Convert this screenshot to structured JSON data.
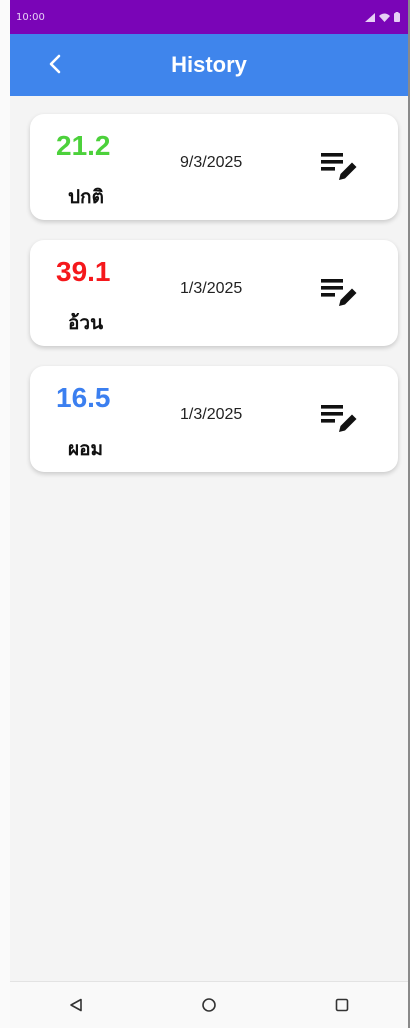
{
  "status_bar": {
    "time": "10:00"
  },
  "app_bar": {
    "title": "History",
    "back_icon": "chevron-left-icon"
  },
  "colors": {
    "normal": "#4cd13b",
    "obese": "#f5181c",
    "underweight": "#3b7ff0",
    "app_bar": "#3f85ec",
    "status_bar": "#7a05b7"
  },
  "records": [
    {
      "value": "21.2",
      "status": "ปกติ",
      "date": "9/3/2025",
      "color": "#4cd13b",
      "action_icon": "edit-list-icon"
    },
    {
      "value": "39.1",
      "status": "อ้วน",
      "date": "1/3/2025",
      "color": "#f5181c",
      "action_icon": "edit-list-icon"
    },
    {
      "value": "16.5",
      "status": "ผอม",
      "date": "1/3/2025",
      "color": "#3b7ff0",
      "action_icon": "edit-list-icon"
    }
  ],
  "nav": {
    "back_icon": "triangle-back-icon",
    "home_icon": "circle-home-icon",
    "recents_icon": "square-recents-icon"
  }
}
